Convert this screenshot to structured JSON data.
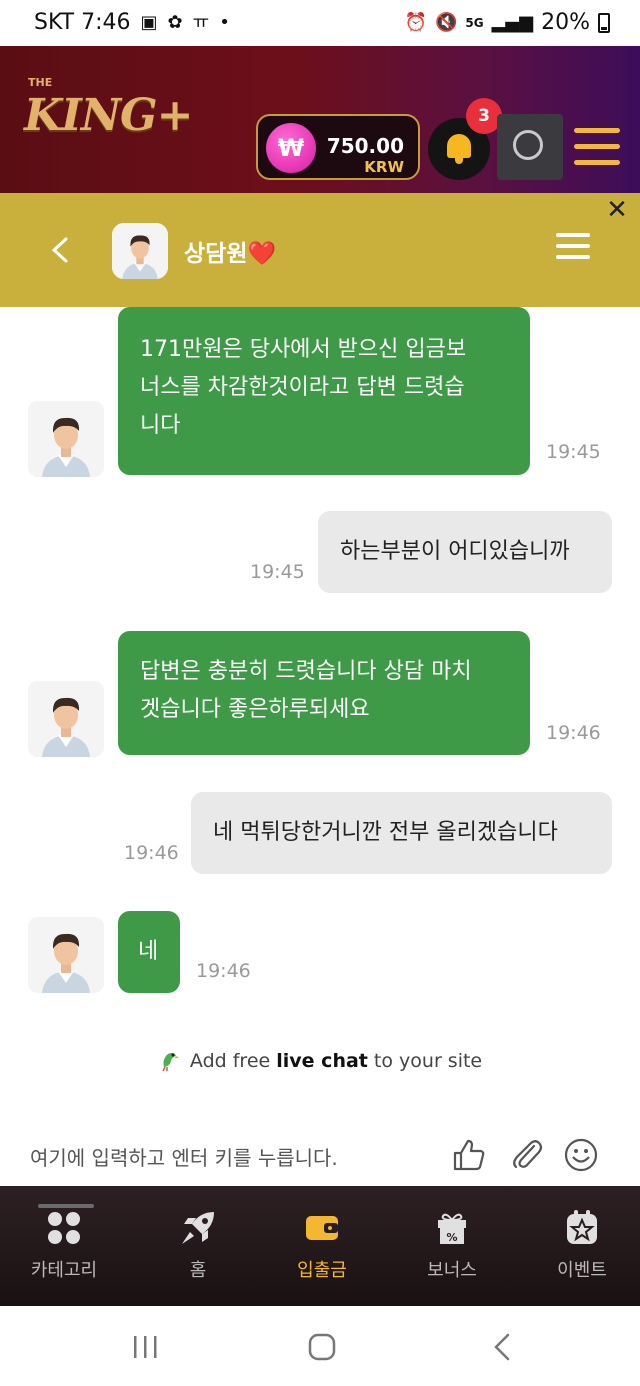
{
  "status_bar": {
    "carrier_time": "SKT 7:46",
    "battery": "20%",
    "network": "5G"
  },
  "header": {
    "logo_text": "KING+",
    "logo_small": "THE",
    "balance_amount": "750.00",
    "balance_currency": "KRW",
    "currency_symbol": "₩",
    "notification_count": "3"
  },
  "chat_header": {
    "agent_name": "상담원❤️"
  },
  "messages": [
    {
      "sender": "agent",
      "lines": [
        "171만원은 당사에서 받으신 입금보",
        "너스를 차감한것이라고 답변 드렷습",
        "니다"
      ],
      "time": "19:45"
    },
    {
      "sender": "user",
      "lines": [
        "하는부분이 어디있습니까"
      ],
      "time": "19:45"
    },
    {
      "sender": "agent",
      "lines": [
        "답변은 충분히 드렷습니다 상담 마치",
        "겟습니다 좋은하루되세요"
      ],
      "time": "19:46"
    },
    {
      "sender": "user",
      "lines": [
        "네 먹튀당한거니깐 전부 올리겠습니다"
      ],
      "time": "19:46"
    },
    {
      "sender": "agent",
      "lines": [
        "네"
      ],
      "time": "19:46"
    }
  ],
  "powered_by": {
    "prefix": "Add free",
    "bold": "live chat",
    "suffix": "to your site"
  },
  "composer": {
    "placeholder": "여기에 입력하고 엔터 키를 누릅니다."
  },
  "bottom_nav": {
    "items": [
      {
        "label": "카테고리",
        "icon": "category-grid-icon"
      },
      {
        "label": "홈",
        "icon": "rocket-icon"
      },
      {
        "label": "입출금",
        "icon": "wallet-icon",
        "active": true
      },
      {
        "label": "보너스",
        "icon": "gift-icon"
      },
      {
        "label": "이벤트",
        "icon": "star-badge-icon"
      }
    ]
  },
  "colors": {
    "header_gradient_start": "#5a0d14",
    "header_gradient_end": "#3d0d5a",
    "chat_header_bg": "#c9b03c",
    "agent_bubble": "#3f9a48",
    "user_bubble": "#e9e9e9",
    "nav_active": "#f3b731"
  }
}
